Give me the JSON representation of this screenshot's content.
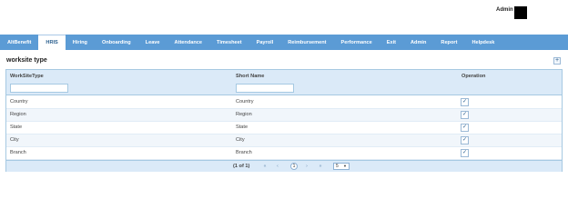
{
  "header": {
    "admin_label": "Admin"
  },
  "nav": {
    "tabs": [
      {
        "label": "AltBenefit"
      },
      {
        "label": "HRIS"
      },
      {
        "label": "Hiring"
      },
      {
        "label": "Onboarding"
      },
      {
        "label": "Leave"
      },
      {
        "label": "Attendance"
      },
      {
        "label": "Timesheet"
      },
      {
        "label": "Payroll"
      },
      {
        "label": "Reimbursement"
      },
      {
        "label": "Performance"
      },
      {
        "label": "Exit"
      },
      {
        "label": "Admin"
      },
      {
        "label": "Report"
      },
      {
        "label": "Helpdesk"
      }
    ],
    "active_index": 1
  },
  "page": {
    "title": "worksite type",
    "add_icon": "+"
  },
  "table": {
    "columns": [
      "WorkSiteType",
      "Short Name",
      "Operation"
    ],
    "filters": {
      "worksite_type": "",
      "short_name": ""
    },
    "rows": [
      {
        "type": "Country",
        "short": "Country"
      },
      {
        "type": "Region",
        "short": "Region"
      },
      {
        "type": "State",
        "short": "State"
      },
      {
        "type": "City",
        "short": "City"
      },
      {
        "type": "Branch",
        "short": "Branch"
      }
    ],
    "edit_icon": "✓"
  },
  "paginator": {
    "info": "(1 of 1)",
    "first": "«",
    "prev": "‹",
    "page": "1",
    "next": "›",
    "last": "»",
    "rows_per_page": "5"
  }
}
